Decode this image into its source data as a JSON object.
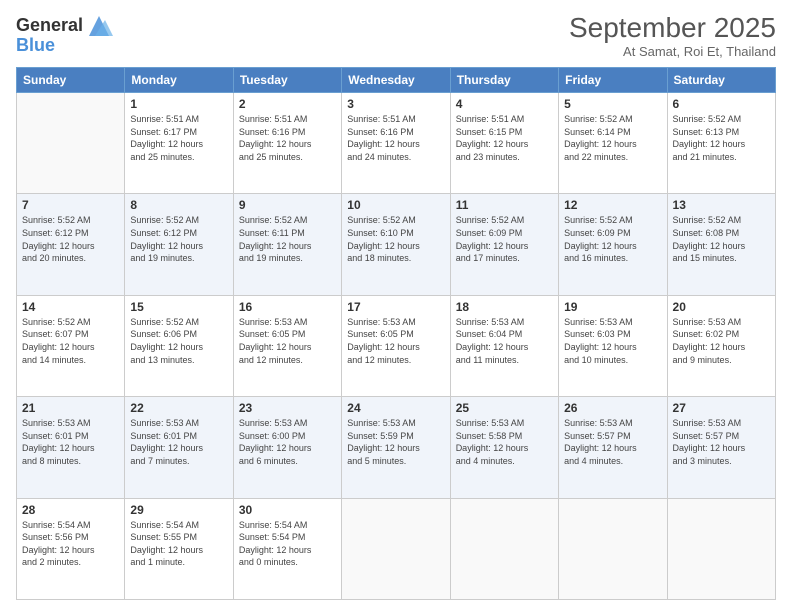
{
  "header": {
    "logo_line1": "General",
    "logo_line2": "Blue",
    "month": "September 2025",
    "location": "At Samat, Roi Et, Thailand"
  },
  "weekdays": [
    "Sunday",
    "Monday",
    "Tuesday",
    "Wednesday",
    "Thursday",
    "Friday",
    "Saturday"
  ],
  "weeks": [
    [
      {
        "day": "",
        "info": ""
      },
      {
        "day": "1",
        "info": "Sunrise: 5:51 AM\nSunset: 6:17 PM\nDaylight: 12 hours\nand 25 minutes."
      },
      {
        "day": "2",
        "info": "Sunrise: 5:51 AM\nSunset: 6:16 PM\nDaylight: 12 hours\nand 25 minutes."
      },
      {
        "day": "3",
        "info": "Sunrise: 5:51 AM\nSunset: 6:16 PM\nDaylight: 12 hours\nand 24 minutes."
      },
      {
        "day": "4",
        "info": "Sunrise: 5:51 AM\nSunset: 6:15 PM\nDaylight: 12 hours\nand 23 minutes."
      },
      {
        "day": "5",
        "info": "Sunrise: 5:52 AM\nSunset: 6:14 PM\nDaylight: 12 hours\nand 22 minutes."
      },
      {
        "day": "6",
        "info": "Sunrise: 5:52 AM\nSunset: 6:13 PM\nDaylight: 12 hours\nand 21 minutes."
      }
    ],
    [
      {
        "day": "7",
        "info": "Sunrise: 5:52 AM\nSunset: 6:12 PM\nDaylight: 12 hours\nand 20 minutes."
      },
      {
        "day": "8",
        "info": "Sunrise: 5:52 AM\nSunset: 6:12 PM\nDaylight: 12 hours\nand 19 minutes."
      },
      {
        "day": "9",
        "info": "Sunrise: 5:52 AM\nSunset: 6:11 PM\nDaylight: 12 hours\nand 19 minutes."
      },
      {
        "day": "10",
        "info": "Sunrise: 5:52 AM\nSunset: 6:10 PM\nDaylight: 12 hours\nand 18 minutes."
      },
      {
        "day": "11",
        "info": "Sunrise: 5:52 AM\nSunset: 6:09 PM\nDaylight: 12 hours\nand 17 minutes."
      },
      {
        "day": "12",
        "info": "Sunrise: 5:52 AM\nSunset: 6:09 PM\nDaylight: 12 hours\nand 16 minutes."
      },
      {
        "day": "13",
        "info": "Sunrise: 5:52 AM\nSunset: 6:08 PM\nDaylight: 12 hours\nand 15 minutes."
      }
    ],
    [
      {
        "day": "14",
        "info": "Sunrise: 5:52 AM\nSunset: 6:07 PM\nDaylight: 12 hours\nand 14 minutes."
      },
      {
        "day": "15",
        "info": "Sunrise: 5:52 AM\nSunset: 6:06 PM\nDaylight: 12 hours\nand 13 minutes."
      },
      {
        "day": "16",
        "info": "Sunrise: 5:53 AM\nSunset: 6:05 PM\nDaylight: 12 hours\nand 12 minutes."
      },
      {
        "day": "17",
        "info": "Sunrise: 5:53 AM\nSunset: 6:05 PM\nDaylight: 12 hours\nand 12 minutes."
      },
      {
        "day": "18",
        "info": "Sunrise: 5:53 AM\nSunset: 6:04 PM\nDaylight: 12 hours\nand 11 minutes."
      },
      {
        "day": "19",
        "info": "Sunrise: 5:53 AM\nSunset: 6:03 PM\nDaylight: 12 hours\nand 10 minutes."
      },
      {
        "day": "20",
        "info": "Sunrise: 5:53 AM\nSunset: 6:02 PM\nDaylight: 12 hours\nand 9 minutes."
      }
    ],
    [
      {
        "day": "21",
        "info": "Sunrise: 5:53 AM\nSunset: 6:01 PM\nDaylight: 12 hours\nand 8 minutes."
      },
      {
        "day": "22",
        "info": "Sunrise: 5:53 AM\nSunset: 6:01 PM\nDaylight: 12 hours\nand 7 minutes."
      },
      {
        "day": "23",
        "info": "Sunrise: 5:53 AM\nSunset: 6:00 PM\nDaylight: 12 hours\nand 6 minutes."
      },
      {
        "day": "24",
        "info": "Sunrise: 5:53 AM\nSunset: 5:59 PM\nDaylight: 12 hours\nand 5 minutes."
      },
      {
        "day": "25",
        "info": "Sunrise: 5:53 AM\nSunset: 5:58 PM\nDaylight: 12 hours\nand 4 minutes."
      },
      {
        "day": "26",
        "info": "Sunrise: 5:53 AM\nSunset: 5:57 PM\nDaylight: 12 hours\nand 4 minutes."
      },
      {
        "day": "27",
        "info": "Sunrise: 5:53 AM\nSunset: 5:57 PM\nDaylight: 12 hours\nand 3 minutes."
      }
    ],
    [
      {
        "day": "28",
        "info": "Sunrise: 5:54 AM\nSunset: 5:56 PM\nDaylight: 12 hours\nand 2 minutes."
      },
      {
        "day": "29",
        "info": "Sunrise: 5:54 AM\nSunset: 5:55 PM\nDaylight: 12 hours\nand 1 minute."
      },
      {
        "day": "30",
        "info": "Sunrise: 5:54 AM\nSunset: 5:54 PM\nDaylight: 12 hours\nand 0 minutes."
      },
      {
        "day": "",
        "info": ""
      },
      {
        "day": "",
        "info": ""
      },
      {
        "day": "",
        "info": ""
      },
      {
        "day": "",
        "info": ""
      }
    ]
  ]
}
